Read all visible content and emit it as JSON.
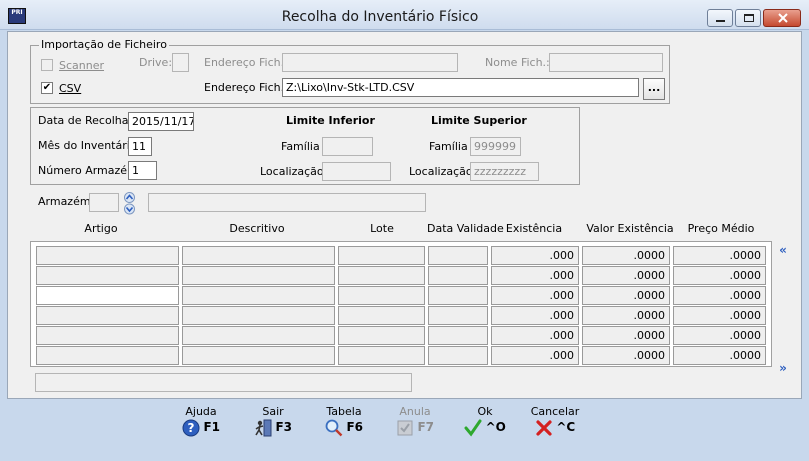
{
  "window": {
    "title": "Recolha do Inventário Físico",
    "app_icon_text": "PRI"
  },
  "import": {
    "group_title": "Importação de Ficheiro",
    "scanner_label": "Scanner",
    "scanner_checked": false,
    "csv_label": "CSV",
    "csv_checked": true,
    "check_mark": "✔",
    "drive_label": "Drive:",
    "drive_value": "",
    "address_label_disabled": "Endereço Fich.:",
    "address_value_disabled": "",
    "filename_label": "Nome Fich.:",
    "filename_value": "",
    "address_label": "Endereço Fich.:",
    "address_value": "Z:\\Lixo\\Inv-Stk-LTD.CSV",
    "browse_label": "..."
  },
  "params": {
    "date_label": "Data de Recolha:",
    "date_value": "2015/11/17",
    "month_label": "Mês do Inventário:",
    "month_value": "11",
    "warehouse_number_label": "Número Armazém",
    "warehouse_number_value": "1",
    "lower_limit_title": "Limite Inferior",
    "upper_limit_title": "Limite Superior",
    "family_label": "Família",
    "lower_family_value": "",
    "upper_family_value": "999999",
    "location_label": "Localização",
    "lower_location_value": "",
    "upper_location_value": "zzzzzzzzz"
  },
  "warehouse": {
    "label": "Armazém:",
    "code_value": "",
    "description_value": ""
  },
  "table": {
    "columns": [
      "Artigo",
      "Descritivo",
      "Lote",
      "Data Validade",
      "Existência",
      "Valor Existência",
      "Preço Médio"
    ],
    "rows": [
      {
        "artigo": "",
        "descritivo": "",
        "lote": "",
        "data_validade": "",
        "existencia": ".000",
        "valor": ".0000",
        "preco": ".0000"
      },
      {
        "artigo": "",
        "descritivo": "",
        "lote": "",
        "data_validade": "",
        "existencia": ".000",
        "valor": ".0000",
        "preco": ".0000"
      },
      {
        "artigo": "",
        "descritivo": "",
        "lote": "",
        "data_validade": "",
        "existencia": ".000",
        "valor": ".0000",
        "preco": ".0000"
      },
      {
        "artigo": "",
        "descritivo": "",
        "lote": "",
        "data_validade": "",
        "existencia": ".000",
        "valor": ".0000",
        "preco": ".0000"
      },
      {
        "artigo": "",
        "descritivo": "",
        "lote": "",
        "data_validade": "",
        "existencia": ".000",
        "valor": ".0000",
        "preco": ".0000"
      },
      {
        "artigo": "",
        "descritivo": "",
        "lote": "",
        "data_validade": "",
        "existencia": ".000",
        "valor": ".0000",
        "preco": ".0000"
      }
    ],
    "scroll_left": "«",
    "scroll_right": "»",
    "status_value": ""
  },
  "toolbar": {
    "help": {
      "label": "Ajuda",
      "key": "F1",
      "icon": "help-icon"
    },
    "exit": {
      "label": "Sair",
      "key": "F3",
      "icon": "exit-icon"
    },
    "table": {
      "label": "Tabela",
      "key": "F6",
      "icon": "search-icon"
    },
    "update": {
      "label": "Anula",
      "key": "F7",
      "icon": "update-icon"
    },
    "ok": {
      "label": "Ok",
      "key": "^O",
      "icon": "check-icon"
    },
    "cancel": {
      "label": "Cancelar",
      "key": "^C",
      "icon": "cancel-icon"
    }
  },
  "colors": {
    "accent_blue": "#2e5fbf",
    "ok_green": "#2ea82e",
    "cancel_red": "#d42020",
    "window_frame": "#c8d8ec"
  }
}
